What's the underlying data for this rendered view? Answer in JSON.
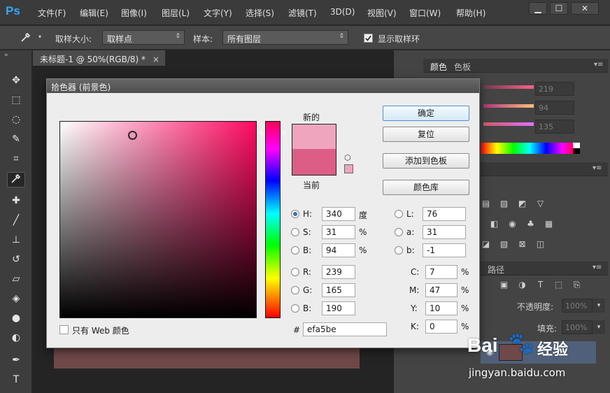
{
  "app": {
    "logo": "Ps"
  },
  "menubar": {
    "items": [
      "文件(F)",
      "编辑(E)",
      "图像(I)",
      "图层(L)",
      "文字(Y)",
      "选择(S)",
      "滤镜(T)",
      "3D(D)",
      "视图(V)",
      "窗口(W)",
      "帮助(H)"
    ],
    "minimize": "▁",
    "maximize": "☐",
    "close": "✕"
  },
  "options_bar": {
    "sample_size_label": "取样大小:",
    "sample_size_value": "取样点",
    "sample_label": "样本:",
    "sample_value": "所有图层",
    "show_ring_label": "显示取样环",
    "show_ring_checked": true
  },
  "document": {
    "tab_title": "未标题-1 @ 50%(RGB/8) *",
    "close": "×"
  },
  "right_panels": {
    "color_tab": "颜色",
    "swatches_tab": "色板",
    "r_value": "219",
    "g_value": "94",
    "b_value": "135",
    "paths_tab": "路径",
    "opacity_label": "不透明度:",
    "opacity_value": "100%",
    "fill_label": "填充:",
    "fill_value": "100%",
    "foreground_color": "#db5e87"
  },
  "color_picker": {
    "title": "拾色器 (前景色)",
    "new_label": "新的",
    "current_label": "当前",
    "new_color": "#efa5be",
    "current_color": "#dc5e87",
    "ok": "确定",
    "reset": "复位",
    "add_to_swatches": "添加到色板",
    "color_libraries": "颜色库",
    "web_only": "只有 Web 颜色",
    "hash": "#",
    "hex": "efa5be",
    "hsb": {
      "h_label": "H:",
      "h": "340",
      "h_unit": "度",
      "s_label": "S:",
      "s": "31",
      "s_unit": "%",
      "b_label": "B:",
      "b": "94",
      "b_unit": "%"
    },
    "rgb": {
      "r_label": "R:",
      "r": "239",
      "g_label": "G:",
      "g": "165",
      "b_label": "B:",
      "b": "190"
    },
    "lab": {
      "l_label": "L:",
      "l": "76",
      "a_label": "a:",
      "a": "31",
      "b_label": "b:",
      "b": "-1"
    },
    "cmyk": {
      "c_label": "C:",
      "c": "7",
      "m_label": "M:",
      "m": "47",
      "y_label": "Y:",
      "y": "10",
      "k_label": "K:",
      "k": "0",
      "unit": "%"
    }
  },
  "watermark": {
    "brand": "Bai",
    "paw": "🐾",
    "text": "经验",
    "url": "jingyan.baidu.com"
  }
}
